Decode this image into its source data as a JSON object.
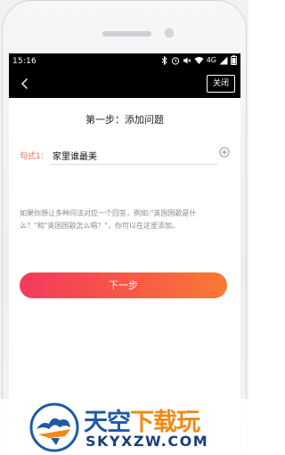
{
  "status_bar": {
    "time": "15:16",
    "network": "4G"
  },
  "nav": {
    "close_label": "关闭"
  },
  "page": {
    "title": "第一步：添加问题",
    "pattern_label": "句式1:",
    "pattern_value": "家里谁最美",
    "hint": "如果你想让多种问法对应一个回答，例如:\"英国国歌是什么？\"和\"英国国歌怎么唱？\"，你可以在这里添加。",
    "next_label": "下一步"
  },
  "watermark": {
    "title_part1": "天空",
    "title_part2": "下载玩",
    "domain": "SKYXZW.COM"
  },
  "colors": {
    "accent_label": "#f06b4d",
    "button_start": "#f43a5e",
    "button_end": "#f97a34"
  }
}
